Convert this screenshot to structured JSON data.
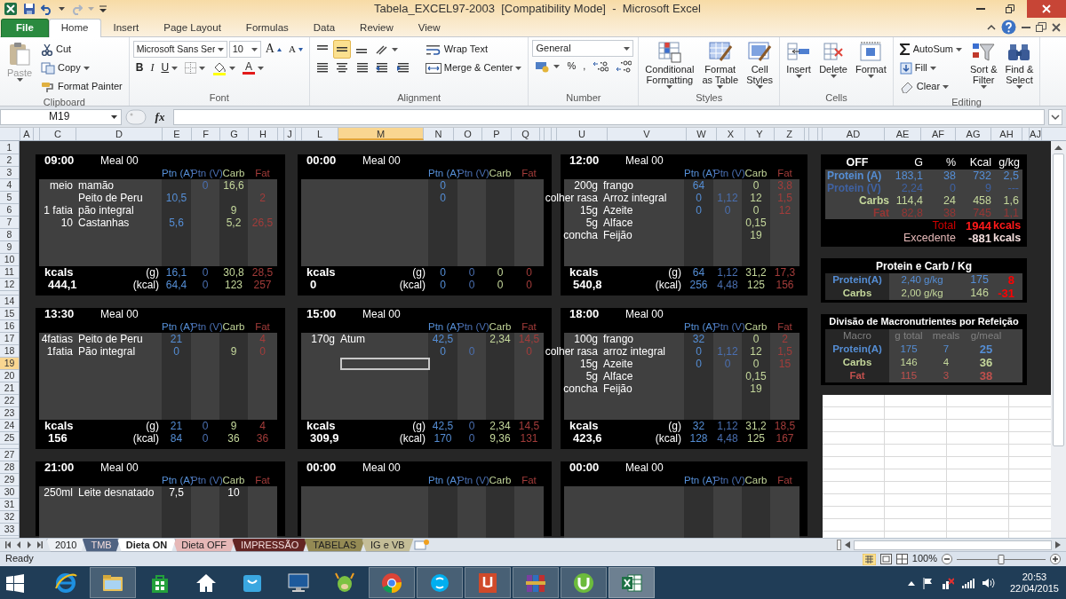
{
  "window": {
    "title": "Tabela_EXCEL97-2003  [Compatibility Mode]  -  Microsoft Excel"
  },
  "ribbon_tabs": [
    {
      "label": "File",
      "kind": "file",
      "selected": false
    },
    {
      "label": "Home",
      "kind": "tab",
      "selected": true
    },
    {
      "label": "Insert",
      "kind": "tab",
      "selected": false
    },
    {
      "label": "Page Layout",
      "kind": "tab",
      "selected": false
    },
    {
      "label": "Formulas",
      "kind": "tab",
      "selected": false
    },
    {
      "label": "Data",
      "kind": "tab",
      "selected": false
    },
    {
      "label": "Review",
      "kind": "tab",
      "selected": false
    },
    {
      "label": "View",
      "kind": "tab",
      "selected": false
    }
  ],
  "clipboard": {
    "label": "Clipboard",
    "paste": {
      "label": "Paste",
      "disabled": true
    },
    "cut": "Cut",
    "copy": "Copy",
    "format_painter": "Format Painter"
  },
  "font": {
    "label": "Font",
    "name": "Microsoft Sans Ser",
    "size": "10",
    "grow": "A",
    "shrink": "A",
    "bold": "B",
    "italic": "I",
    "underline": "U",
    "font_color": "A"
  },
  "alignment": {
    "label": "Alignment",
    "valign": [
      {
        "selected": false
      },
      {
        "selected": true
      },
      {
        "selected": false
      }
    ],
    "wrap_text": "Wrap Text",
    "merge_center": "Merge & Center"
  },
  "number": {
    "label": "Number",
    "format": "General",
    "percent": "%",
    "comma": ","
  },
  "styles": {
    "label": "Styles",
    "buttons": [
      {
        "lines": [
          "Conditional",
          "Formatting"
        ],
        "kind": "conditional"
      },
      {
        "lines": [
          "Format",
          "as Table"
        ],
        "kind": "table"
      },
      {
        "lines": [
          "Cell",
          "Styles"
        ],
        "kind": "cellstyles"
      }
    ]
  },
  "cells": {
    "label": "Cells",
    "buttons": [
      {
        "lines": [
          "Insert"
        ],
        "kind": "insert"
      },
      {
        "lines": [
          "Delete"
        ],
        "kind": "delete"
      },
      {
        "lines": [
          "Format"
        ],
        "kind": "format"
      }
    ]
  },
  "editing": {
    "label": "Editing",
    "autosum": "AutoSum",
    "fill": "Fill",
    "clear": "Clear",
    "buttons": [
      {
        "lines": [
          "Sort &",
          "Filter"
        ],
        "kind": "sort"
      },
      {
        "lines": [
          "Find &",
          "Select"
        ],
        "kind": "find"
      }
    ]
  },
  "formula_bar": {
    "name_box": "M19",
    "fx": "fx"
  },
  "columns": [
    {
      "letter": "A",
      "selected": false
    },
    {
      "letter": "C",
      "selected": false
    },
    {
      "letter": "D",
      "selected": false
    },
    {
      "letter": "E",
      "selected": false
    },
    {
      "letter": "F",
      "selected": false
    },
    {
      "letter": "G",
      "selected": false
    },
    {
      "letter": "H",
      "selected": false
    },
    {
      "letter": "J",
      "selected": false
    },
    {
      "letter": "L",
      "selected": false
    },
    {
      "letter": "M",
      "selected": true
    },
    {
      "letter": "N",
      "selected": false
    },
    {
      "letter": "O",
      "selected": false
    },
    {
      "letter": "P",
      "selected": false
    },
    {
      "letter": "Q",
      "selected": false
    },
    {
      "letter": "U",
      "selected": false
    },
    {
      "letter": "V",
      "selected": false
    },
    {
      "letter": "W",
      "selected": false
    },
    {
      "letter": "X",
      "selected": false
    },
    {
      "letter": "Y",
      "selected": false
    },
    {
      "letter": "Z",
      "selected": false
    },
    {
      "letter": "AD",
      "selected": false
    },
    {
      "letter": "AE",
      "selected": false
    },
    {
      "letter": "AF",
      "selected": false
    },
    {
      "letter": "AG",
      "selected": false
    },
    {
      "letter": "AH",
      "selected": false
    },
    {
      "letter": "AJ",
      "selected": false
    }
  ],
  "rows": [
    {
      "label": "1",
      "selected": false
    },
    {
      "label": "2",
      "selected": false
    },
    {
      "label": "3",
      "selected": false
    },
    {
      "label": "4",
      "selected": false
    },
    {
      "label": "5",
      "selected": false
    },
    {
      "label": "6",
      "selected": false
    },
    {
      "label": "7",
      "selected": false
    },
    {
      "label": "8",
      "selected": false
    },
    {
      "label": "9",
      "selected": false
    },
    {
      "label": "10",
      "selected": false
    },
    {
      "label": "11",
      "selected": false
    },
    {
      "label": "12",
      "selected": false
    },
    {
      "label": "14",
      "selected": false
    },
    {
      "label": "15",
      "selected": false
    },
    {
      "label": "16",
      "selected": false
    },
    {
      "label": "17",
      "selected": false
    },
    {
      "label": "18",
      "selected": false
    },
    {
      "label": "19",
      "selected": true
    },
    {
      "label": "20",
      "selected": false
    },
    {
      "label": "21",
      "selected": false
    },
    {
      "label": "22",
      "selected": false
    },
    {
      "label": "23",
      "selected": false
    },
    {
      "label": "24",
      "selected": false
    },
    {
      "label": "25",
      "selected": false
    },
    {
      "label": "27",
      "selected": false
    },
    {
      "label": "28",
      "selected": false
    },
    {
      "label": "29",
      "selected": false
    },
    {
      "label": "30",
      "selected": false
    },
    {
      "label": "31",
      "selected": false
    },
    {
      "label": "32",
      "selected": false
    },
    {
      "label": "33",
      "selected": false
    }
  ],
  "meals": [
    {
      "time": "09:00",
      "label": "Meal 00",
      "columns": [
        {
          "label": "Ptn (A)",
          "color": "#558ed5"
        },
        {
          "label": "Ptn (V)",
          "color": "#4a6fb0"
        },
        {
          "label": "Carb",
          "color": "#c4d79b"
        },
        {
          "label": "Fat",
          "color": "#a33c3a"
        }
      ],
      "items": [
        {
          "qty": "meio",
          "food": "mamão",
          "values": {
            "ptn_v": "0",
            "carb": "16,6"
          },
          "kind": "macro",
          "active": false
        },
        {
          "food": "Peito de Peru",
          "values": {
            "ptn_a": "10,5",
            "fat": "2"
          },
          "kind": "macro",
          "active": false
        },
        {
          "qty": "1 fatia",
          "food": "pão integral",
          "values": {
            "carb": "9"
          },
          "kind": "macro",
          "active": false
        },
        {
          "qty": "10",
          "food": "Castanhas",
          "values": {
            "ptn_a": "5,6",
            "carb": "5,2",
            "fat": "26,5"
          },
          "kind": "macro",
          "active": false
        }
      ],
      "totals": {
        "label": "kcals",
        "value": "444,1",
        "g_label": "(g)",
        "kcal_label": "(kcal)",
        "g": [
          "16,1",
          "0",
          "30,8",
          "28,5"
        ],
        "kcal": [
          "64,4",
          "0",
          "123",
          "257"
        ]
      }
    },
    {
      "time": "00:00",
      "label": "Meal 00",
      "columns": [
        {
          "label": "Ptn (A)",
          "color": "#558ed5"
        },
        {
          "label": "Ptn (V)",
          "color": "#4a6fb0"
        },
        {
          "label": "Carb",
          "color": "#c4d79b"
        },
        {
          "label": "Fat",
          "color": "#a33c3a"
        }
      ],
      "items": [
        {
          "values": {
            "ptn_a": "0"
          },
          "kind": "macro",
          "active": false
        },
        {
          "values": {
            "ptn_a": "0"
          },
          "kind": "macro",
          "active": false
        }
      ],
      "totals": {
        "label": "kcals",
        "value": "0",
        "g_label": "(g)",
        "kcal_label": "(kcal)",
        "g": [
          "0",
          "0",
          "0",
          "0"
        ],
        "kcal": [
          "0",
          "0",
          "0",
          "0"
        ]
      }
    },
    {
      "time": "12:00",
      "label": "Meal 00",
      "columns": [
        {
          "label": "Ptn (A)",
          "color": "#558ed5"
        },
        {
          "label": "Ptn (V)",
          "color": "#4a6fb0"
        },
        {
          "label": "Carb",
          "color": "#c4d79b"
        },
        {
          "label": "Fat",
          "color": "#a33c3a"
        }
      ],
      "items": [
        {
          "qty": "200g",
          "food": "frango",
          "values": {
            "ptn_a": "64",
            "carb": "0",
            "fat": "3,8"
          },
          "kind": "macro",
          "active": false
        },
        {
          "qty": "colher rasa",
          "food": "Arroz integral",
          "values": {
            "ptn_a": "0",
            "ptn_v": "1,12",
            "carb": "12",
            "fat": "1,5"
          },
          "kind": "macro",
          "active": false
        },
        {
          "qty": "15g",
          "food": "Azeite",
          "values": {
            "ptn_a": "0",
            "ptn_v": "0",
            "carb": "0",
            "fat": "12"
          },
          "kind": "macro",
          "active": false
        },
        {
          "qty": "5g",
          "food": "Alface",
          "values": {
            "carb": "0,15"
          },
          "kind": "macro",
          "active": false
        },
        {
          "qty": "concha",
          "food": "Feijão",
          "values": {
            "carb": "19"
          },
          "kind": "macro",
          "active": false
        }
      ],
      "totals": {
        "label": "kcals",
        "value": "540,8",
        "g_label": "(g)",
        "kcal_label": "(kcal)",
        "g": [
          "64",
          "1,12",
          "31,2",
          "17,3"
        ],
        "kcal": [
          "256",
          "4,48",
          "125",
          "156"
        ]
      }
    },
    {
      "time": "13:30",
      "label": "Meal 00",
      "columns": [
        {
          "label": "Ptn (A)",
          "color": "#558ed5"
        },
        {
          "label": "Ptn (V)",
          "color": "#4a6fb0"
        },
        {
          "label": "Carb",
          "color": "#c4d79b"
        },
        {
          "label": "Fat",
          "color": "#a33c3a"
        }
      ],
      "items": [
        {
          "qty": "4fatias",
          "food": "Peito de Peru",
          "values": {
            "ptn_a": "21",
            "fat": "4"
          },
          "kind": "macro",
          "active": false
        },
        {
          "qty": "1fatia",
          "food": "Pão integral",
          "values": {
            "ptn_a": "0",
            "carb": "9",
            "fat": "0"
          },
          "kind": "macro",
          "active": false
        }
      ],
      "totals": {
        "label": "kcals",
        "value": "156",
        "g_label": "(g)",
        "kcal_label": "(kcal)",
        "g": [
          "21",
          "0",
          "9",
          "4"
        ],
        "kcal": [
          "84",
          "0",
          "36",
          "36"
        ]
      }
    },
    {
      "time": "15:00",
      "label": "Meal 00",
      "columns": [
        {
          "label": "Ptn (A)",
          "color": "#558ed5"
        },
        {
          "label": "Ptn (V)",
          "color": "#4a6fb0"
        },
        {
          "label": "Carb",
          "color": "#c4d79b"
        },
        {
          "label": "Fat",
          "color": "#a33c3a"
        }
      ],
      "items": [
        {
          "qty": "170g",
          "food": "Atum",
          "values": {
            "ptn_a": "42,5",
            "carb": "2,34",
            "fat": "14,5"
          },
          "kind": "macro",
          "active": false
        },
        {
          "values": {
            "ptn_a": "0",
            "ptn_v": "0",
            "fat": "0"
          },
          "kind": "macro",
          "active": false
        },
        {
          "active": true
        }
      ],
      "totals": {
        "label": "kcals",
        "value": "309,9",
        "g_label": "(g)",
        "kcal_label": "(kcal)",
        "g": [
          "42,5",
          "0",
          "2,34",
          "14,5"
        ],
        "kcal": [
          "170",
          "0",
          "9,36",
          "131"
        ]
      }
    },
    {
      "time": "18:00",
      "label": "Meal 00",
      "columns": [
        {
          "label": "Ptn (A)",
          "color": "#558ed5"
        },
        {
          "label": "Ptn (V)",
          "color": "#4a6fb0"
        },
        {
          "label": "Carb",
          "color": "#c4d79b"
        },
        {
          "label": "Fat",
          "color": "#a33c3a"
        }
      ],
      "items": [
        {
          "qty": "100g",
          "food": "frango",
          "values": {
            "ptn_a": "32",
            "carb": "0",
            "fat": "2"
          },
          "kind": "macro",
          "active": false
        },
        {
          "qty": "colher rasa",
          "food": "arroz integral",
          "values": {
            "ptn_a": "0",
            "ptn_v": "1,12",
            "carb": "12",
            "fat": "1,5"
          },
          "kind": "macro",
          "active": false
        },
        {
          "qty": "15g",
          "food": "Azeite",
          "values": {
            "ptn_a": "0",
            "ptn_v": "0",
            "carb": "0",
            "fat": "15"
          },
          "kind": "macro",
          "active": false
        },
        {
          "qty": "5g",
          "food": "Alface",
          "values": {
            "carb": "0,15"
          },
          "kind": "macro",
          "active": false
        },
        {
          "qty": "concha",
          "food": "Feijão",
          "values": {
            "carb": "19"
          },
          "kind": "macro",
          "active": false
        }
      ],
      "totals": {
        "label": "kcals",
        "value": "423,6",
        "g_label": "(g)",
        "kcal_label": "(kcal)",
        "g": [
          "32",
          "1,12",
          "31,2",
          "18,5"
        ],
        "kcal": [
          "128",
          "4,48",
          "125",
          "167"
        ]
      }
    },
    {
      "time": "21:00",
      "label": "Meal 00",
      "columns": [
        {
          "label": "Ptn (A)",
          "color": "#558ed5"
        },
        {
          "label": "Ptn (V)",
          "color": "#4a6fb0"
        },
        {
          "label": "Carb",
          "color": "#c4d79b"
        },
        {
          "label": "Fat",
          "color": "#a33c3a"
        }
      ],
      "items": [
        {
          "qty": "250ml",
          "food": "Leite desnatado",
          "values": {
            "ptn_a": "7,5",
            "carb": "10"
          },
          "kind": "plain",
          "active": false
        }
      ]
    },
    {
      "time": "00:00",
      "label": "Meal 00",
      "columns": [
        {
          "label": "Ptn (A)",
          "color": "#558ed5"
        },
        {
          "label": "Ptn (V)",
          "color": "#4a6fb0"
        },
        {
          "label": "Carb",
          "color": "#c4d79b"
        },
        {
          "label": "Fat",
          "color": "#a33c3a"
        }
      ]
    },
    {
      "time": "00:00",
      "label": "Meal 00",
      "columns": [
        {
          "label": "Ptn (A)",
          "color": "#558ed5"
        },
        {
          "label": "Ptn (V)",
          "color": "#4a6fb0"
        },
        {
          "label": "Carb",
          "color": "#c4d79b"
        },
        {
          "label": "Fat",
          "color": "#a33c3a"
        }
      ]
    }
  ],
  "summary": {
    "headers": [
      "OFF",
      "G",
      "%",
      "Kcal",
      "g/kg"
    ],
    "rows": [
      {
        "label": "Protein (A)",
        "values": [
          "183,1",
          "38",
          "732",
          "2,5"
        ],
        "color": "#558ed5"
      },
      {
        "label": "Protein (V)",
        "values": [
          "2,24",
          "0",
          "9",
          "---"
        ],
        "color": "#3f62a3"
      },
      {
        "label": "Carbs",
        "values": [
          "114,4",
          "24",
          "458",
          "1,6"
        ],
        "color": "#c4d79b"
      },
      {
        "label": "Fat",
        "values": [
          "82,8",
          "38",
          "745",
          "1,1"
        ],
        "color": "#963634"
      }
    ],
    "total": {
      "label": "Total",
      "value": "1944",
      "unit": "kcals"
    },
    "surplus": {
      "label": "Excedente",
      "value": "-881",
      "unit": "kcals"
    }
  },
  "protein_carb": {
    "title": "Protein e Carb / Kg",
    "rows": [
      {
        "label": "Protein(A)",
        "ratio": "2,40",
        "unit": "g/kg",
        "grams": "175",
        "diff": "8",
        "color": "#558ed5"
      },
      {
        "label": "Carbs",
        "ratio": "2,00",
        "unit": "g/kg",
        "grams": "146",
        "diff": "-31",
        "color": "#c4d79b"
      }
    ]
  },
  "division": {
    "title": "Divisão de Macronutrientes por Refeição",
    "headers": [
      "Macro",
      "g total",
      "meals",
      "g/meal"
    ],
    "rows": [
      {
        "label": "Protein(A)",
        "values": [
          "175",
          "7",
          "25"
        ],
        "color": "#558ed5"
      },
      {
        "label": "Carbs",
        "values": [
          "146",
          "4",
          "36"
        ],
        "color": "#c4d79b"
      },
      {
        "label": "Fat",
        "values": [
          "115",
          "3",
          "38"
        ],
        "color": "#c0504d"
      }
    ]
  },
  "sheet_tabs": [
    {
      "label": "2010",
      "selected": false
    },
    {
      "label": "TMB",
      "selected": false,
      "color": "#4f6382"
    },
    {
      "label": "Dieta ON",
      "selected": true
    },
    {
      "label": "Dieta OFF",
      "selected": false,
      "color": "#e6b8b7"
    },
    {
      "label": "IMPRESSÃO",
      "selected": false,
      "color": "#632523"
    },
    {
      "label": "TABELAS",
      "selected": false,
      "color": "#948a54"
    },
    {
      "label": "IG e VB",
      "selected": false,
      "color": "#c4bd97"
    }
  ],
  "status_bar": {
    "text": "Ready",
    "zoom": "100%",
    "zoom_slider": {
      "level": 0.5
    }
  },
  "taskbar": {
    "apps": [
      {
        "kind": "browser",
        "running": false,
        "active": false
      },
      {
        "kind": "folder",
        "running": true,
        "active": false
      },
      {
        "kind": "store",
        "running": false,
        "active": false
      },
      {
        "kind": "home",
        "running": false,
        "active": false
      },
      {
        "kind": "bag",
        "running": false,
        "active": false
      },
      {
        "kind": "monitor",
        "running": false,
        "active": false
      },
      {
        "kind": "creature",
        "running": false,
        "active": false
      },
      {
        "kind": "chrome",
        "running": true,
        "active": false
      },
      {
        "kind": "chat",
        "running": true,
        "active": false
      },
      {
        "kind": "document",
        "running": true,
        "active": false
      },
      {
        "kind": "books",
        "running": true,
        "active": false
      },
      {
        "kind": "download",
        "running": true,
        "active": false
      },
      {
        "kind": "spreadsheet",
        "running": true,
        "active": true
      }
    ],
    "time": "20:53",
    "date": "22/04/2015"
  }
}
